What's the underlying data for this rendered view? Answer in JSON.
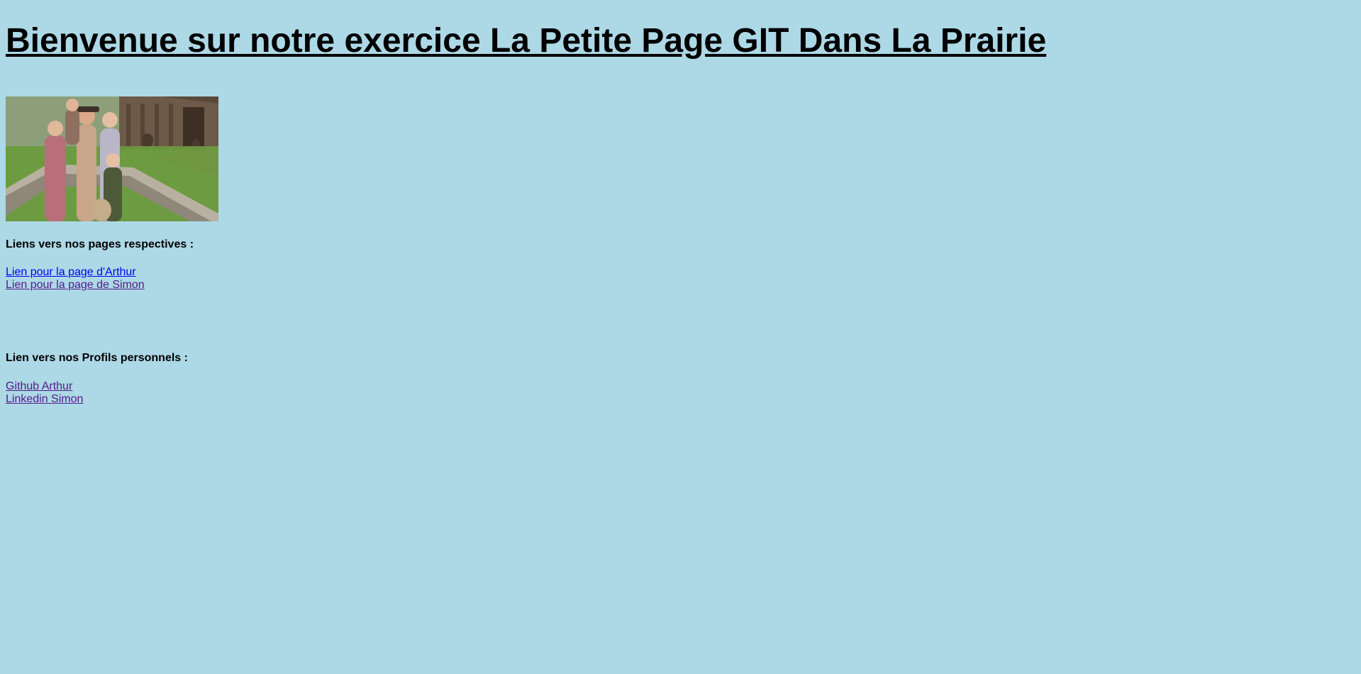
{
  "page": {
    "background": "#add8e6",
    "title": "Bienvenue sur notre exercice La Petite Page GIT Dans La Prairie"
  },
  "hero_image": {
    "subject": "family-photo-prairie"
  },
  "pages_section": {
    "heading": "Liens vers nos pages respectives :",
    "links": [
      {
        "label": "Lien pour la page d'Arthur",
        "color": "#0000ee"
      },
      {
        "label": "Lien pour la page de Simon",
        "color": "#551a8b"
      }
    ]
  },
  "profiles_section": {
    "heading": "Lien vers nos Profils personnels :",
    "links": [
      {
        "label": "Github Arthur",
        "color": "#551a8b"
      },
      {
        "label": "Linkedin Simon",
        "color": "#551a8b"
      }
    ]
  }
}
